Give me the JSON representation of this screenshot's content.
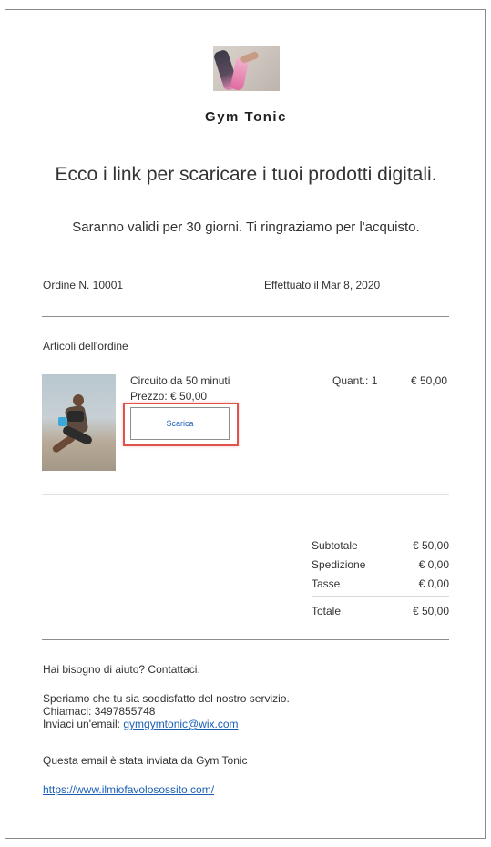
{
  "brand": {
    "name": "Gym Tonic"
  },
  "hero": {
    "headline": "Ecco i link per scaricare i tuoi prodotti digitali.",
    "subheadline": "Saranno validi per 30 giorni. Ti ringraziamo per l'acquisto."
  },
  "order": {
    "number": "Ordine N. 10001",
    "date": "Effettuato il Mar 8, 2020"
  },
  "items": {
    "title": "Articoli dell'ordine",
    "list": [
      {
        "name": "Circuito da 50 minuti",
        "unit_price": "Prezzo: € 50,00",
        "quantity": "Quant.: 1",
        "line_total": "€ 50,00",
        "download_label": "Scarica"
      }
    ]
  },
  "totals": {
    "subtotal_label": "Subtotale",
    "subtotal_value": "€ 50,00",
    "shipping_label": "Spedizione",
    "shipping_value": "€ 0,00",
    "tax_label": "Tasse",
    "tax_value": "€ 0,00",
    "total_label": "Totale",
    "total_value": "€ 50,00"
  },
  "footer": {
    "help": "Hai bisogno di aiuto? Contattaci.",
    "satisfaction": "Speriamo che tu sia soddisfatto del nostro servizio.",
    "phone": "Chiamaci: 3497855748",
    "email_prefix": "Inviaci un'email: ",
    "email": "gymgymtonic@wix.com",
    "sent_by": "Questa email è stata inviata da Gym Tonic",
    "site_url": "https://www.ilmiofavolosossito.com/"
  },
  "colors": {
    "link": "#1a5fb4",
    "highlight": "#e0534a"
  }
}
